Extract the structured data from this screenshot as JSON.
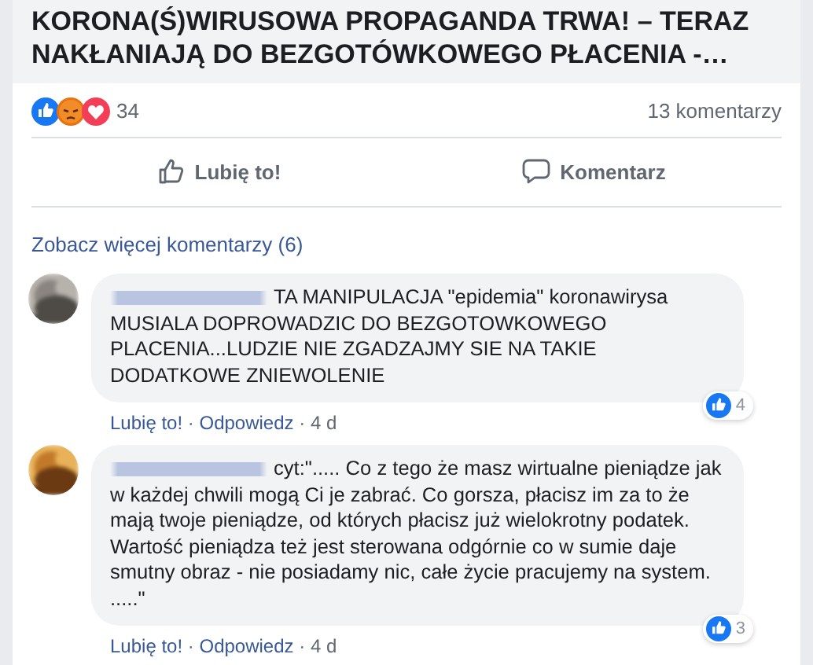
{
  "post": {
    "title": "KORONA(Ś)WIRUSOWA PROPAGANDA TRWA! – TERAZ NAKŁANIAJĄ DO BEZGOTÓWKOWEGO PŁACENIA -…",
    "reactions_count": "34",
    "comments_count": "13 komentarzy",
    "actions": [
      {
        "label": "Lubię to!",
        "kind": "like"
      },
      {
        "label": "Komentarz",
        "kind": "comment"
      }
    ]
  },
  "more_comments": "Zobacz więcej komentarzy (6)",
  "comments": [
    {
      "text": "TA MANIPULACJA \"epidemia\" koronawirysa MUSIALA DOPROWADZIC DO BEZGOTOWKOWEGO PLACENIA...LUDZIE NIE ZGADZAJMY SIE NA TAKIE DODATKOWE ZNIEWOLENIE",
      "likes": "4",
      "like_link": "Lubię to!",
      "separator_1": "·",
      "reply_link": "Odpowiedz",
      "separator_2": "·",
      "time": "4 d"
    },
    {
      "text": "cyt:\"..... Co z tego że masz wirtualne pieniądze jak w każdej chwili mogą Ci je zabrać. Co gorsza, płacisz im za to że mają twoje pieniądze, od których płacisz już wielokrotny podatek. Wartość pieniądza też jest sterowana odgórnie co w sumie daje smutny obraz - nie posiadamy nic, całe życie pracujemy na system. .....\"",
      "likes": "3",
      "like_link": "Lubię to!",
      "separator_1": "·",
      "reply_link": "Odpowiedz",
      "separator_2": "·",
      "time": "4 d"
    }
  ]
}
